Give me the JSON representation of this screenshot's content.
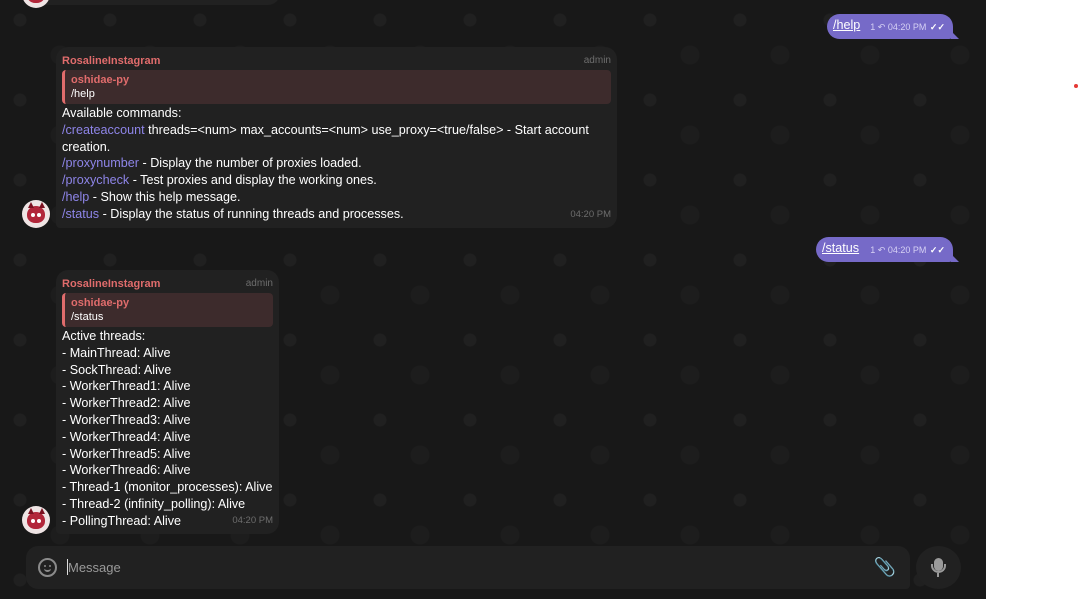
{
  "messages_out": [
    {
      "text": "/help",
      "replies": "1",
      "time": "04:20 PM",
      "status": "read"
    },
    {
      "text": "/status",
      "replies": "1",
      "time": "04:20 PM",
      "status": "read"
    }
  ],
  "help_reply": {
    "sender": "RosalineInstagram",
    "role": "admin",
    "reply_to_name": "oshidae-py",
    "reply_to_text": "/help",
    "lines": [
      {
        "text": "Available commands:"
      },
      {
        "cmd": "/createaccount",
        "text": " threads=<num> max_accounts=<num> use_proxy=<true/false> - Start account"
      },
      {
        "text": "creation."
      },
      {
        "cmd": "/proxynumber",
        "text": " - Display the number of proxies loaded."
      },
      {
        "cmd": "/proxycheck",
        "text": " - Test proxies and display the working ones."
      },
      {
        "cmd": "/help",
        "text": " - Show this help message."
      },
      {
        "cmd": "/status",
        "text": " - Display the status of running threads and processes."
      }
    ],
    "time": "04:20 PM"
  },
  "status_reply": {
    "sender": "RosalineInstagram",
    "role": "admin",
    "reply_to_name": "oshidae-py",
    "reply_to_text": "/status",
    "lines": [
      "Active threads:",
      "- MainThread: Alive",
      "- SockThread: Alive",
      "- WorkerThread1: Alive",
      "- WorkerThread2: Alive",
      "- WorkerThread3: Alive",
      "- WorkerThread4: Alive",
      "- WorkerThread5: Alive",
      "- WorkerThread6: Alive",
      "- Thread-1 (monitor_processes): Alive",
      "- Thread-2 (infinity_polling): Alive",
      "- PollingThread: Alive"
    ],
    "time": "04:20 PM"
  },
  "composer": {
    "placeholder": "Message"
  },
  "icons": {
    "emoji": "smile-icon",
    "attach": "paperclip-icon",
    "mic": "microphone-icon",
    "reply": "reply-arrow-icon",
    "read": "double-check-icon"
  },
  "colors": {
    "background": "#181818",
    "bubble_in": "#212121",
    "bubble_out": "#766ac8",
    "command": "#8e85e8",
    "sender": "#e06c6c"
  }
}
